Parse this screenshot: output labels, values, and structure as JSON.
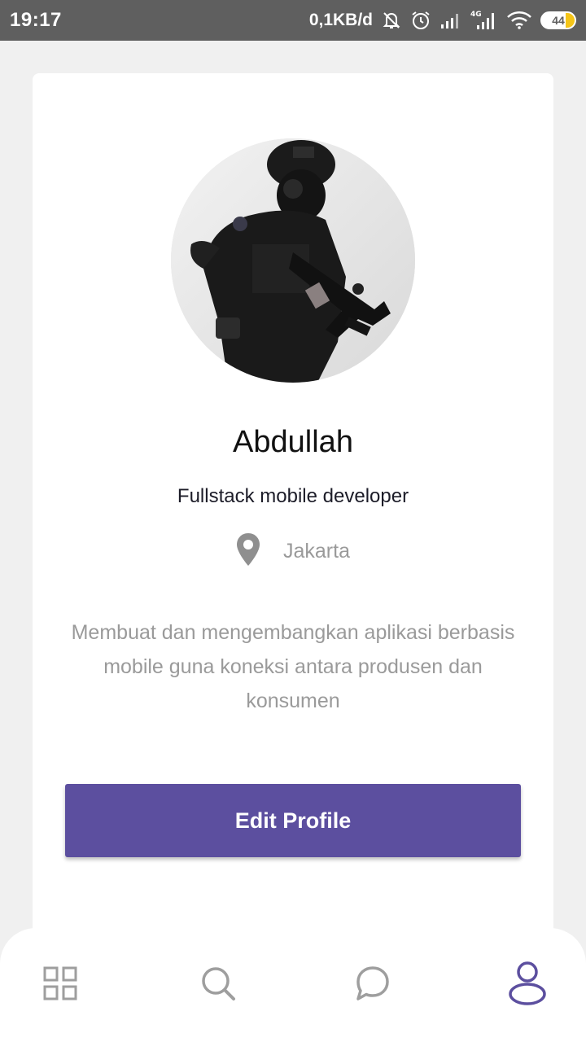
{
  "status_bar": {
    "time": "19:17",
    "network_speed": "0,1KB/d",
    "battery_level": "44",
    "icons": [
      "mute-icon",
      "alarm-icon",
      "signal-icon",
      "4g-signal-icon",
      "wifi-icon",
      "battery-icon"
    ]
  },
  "profile": {
    "name": "Abdullah",
    "role": "Fullstack mobile developer",
    "location": "Jakarta",
    "bio": "Membuat dan mengembangkan aplikasi berbasis mobile guna koneksi antara produsen dan konsumen",
    "edit_button_label": "Edit Profile"
  },
  "bottom_nav": {
    "items": [
      {
        "icon": "grid-icon",
        "active": false
      },
      {
        "icon": "search-icon",
        "active": false
      },
      {
        "icon": "chat-icon",
        "active": false
      },
      {
        "icon": "profile-icon",
        "active": true
      }
    ]
  },
  "colors": {
    "accent": "#5c4f9f",
    "status_bar": "#5f5f5f",
    "background": "#f0f0f0",
    "muted_text": "#9a9a9a",
    "inactive_icon": "#9e9e9e"
  }
}
